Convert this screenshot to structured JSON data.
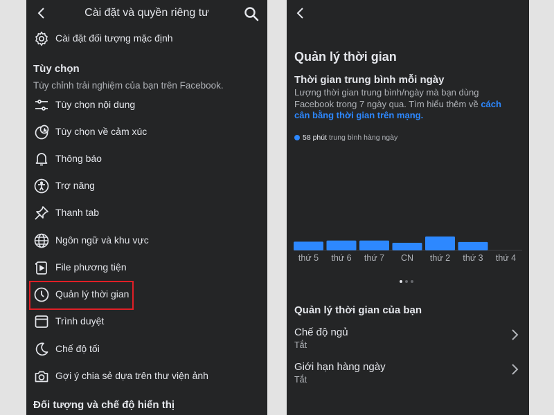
{
  "left": {
    "header": {
      "title": "Cài đặt và quyền riêng tư"
    },
    "top_item": {
      "label": "Cài đặt đối tượng mặc định",
      "icon": "gear-icon"
    },
    "preferences": {
      "title": "Tùy chọn",
      "subtitle": "Tùy chỉnh trải nghiệm của bạn trên Facebook.",
      "items": [
        {
          "label": "Tùy chọn nội dung",
          "icon": "sliders-icon"
        },
        {
          "label": "Tùy chọn về cảm xúc",
          "icon": "reaction-icon"
        },
        {
          "label": "Thông báo",
          "icon": "bell-icon"
        },
        {
          "label": "Trợ năng",
          "icon": "accessibility-icon"
        },
        {
          "label": "Thanh tab",
          "icon": "pin-icon"
        },
        {
          "label": "Ngôn ngữ và khu vực",
          "icon": "globe-icon"
        },
        {
          "label": "File phương tiện",
          "icon": "media-file-icon"
        },
        {
          "label": "Quản lý thời gian",
          "icon": "clock-icon",
          "highlighted": true
        },
        {
          "label": "Trình duyệt",
          "icon": "browser-icon"
        },
        {
          "label": "Chế độ tối",
          "icon": "moon-icon"
        },
        {
          "label": "Gợi ý chia sẻ dựa trên thư viện ảnh",
          "icon": "camera-icon"
        }
      ]
    },
    "next_section_title": "Đối tượng và chế độ hiển thị"
  },
  "right": {
    "title": "Quản lý thời gian",
    "subtitle": "Thời gian trung bình mỗi ngày",
    "desc_line1": "Lượng thời gian trung bình/ngày mà bạn dùng",
    "desc_line2_plain": "Facebook trong 7 ngày qua. Tìm hiểu thêm về ",
    "desc_line2_link": "cách",
    "desc_line3_link": "cân bằng thời gian trên mạng.",
    "legend_value": "58 phút",
    "legend_text": "trung bình hàng ngày",
    "section_title": "Quản lý thời gian của bạn",
    "settings": [
      {
        "title": "Chế độ ngủ",
        "status": "Tắt"
      },
      {
        "title": "Giới hạn hàng ngày",
        "status": "Tắt"
      }
    ],
    "pager": {
      "pages": 3,
      "active": 1
    }
  },
  "colors": {
    "accent": "#2d88ff",
    "panel": "#242526",
    "highlight_border": "#e01f26",
    "background": "#e3e3e3"
  },
  "chart_data": {
    "type": "bar",
    "categories": [
      "thứ 5",
      "thứ 6",
      "thứ 7",
      "CN",
      "thứ 2",
      "thứ 3",
      "thứ 4"
    ],
    "values": [
      54,
      61,
      61,
      47,
      86,
      52,
      0
    ]
  }
}
